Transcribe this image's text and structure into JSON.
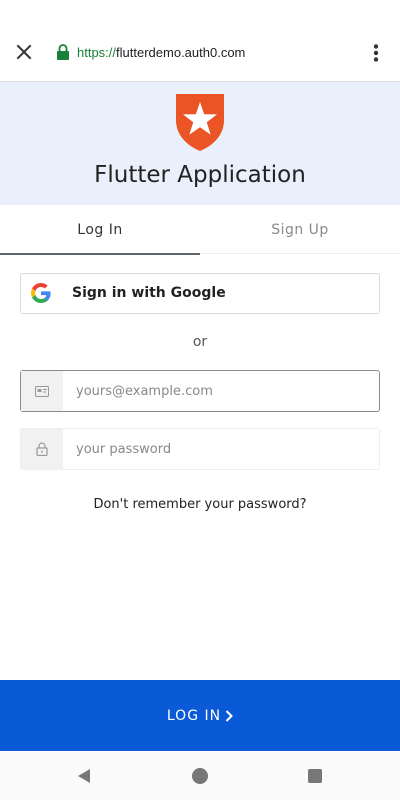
{
  "browser": {
    "url_scheme": "https://",
    "url_host": "flutterdemo.auth0.com",
    "accent_color": "#188038"
  },
  "header": {
    "title": "Flutter Application",
    "logo_icon": "auth0-shield-star-icon",
    "logo_color": "#eb5424",
    "background": "#e9f0fb"
  },
  "tabs": [
    {
      "label": "Log In",
      "active": true
    },
    {
      "label": "Sign Up",
      "active": false
    }
  ],
  "google_button": {
    "label": "Sign in with Google",
    "icon": "google-g-icon"
  },
  "separator": "or",
  "email_input": {
    "placeholder": "yours@example.com",
    "value": "",
    "icon": "id-card-icon"
  },
  "password_input": {
    "placeholder": "your password",
    "value": "",
    "icon": "lock-icon"
  },
  "forgot_password": "Don't remember your password?",
  "submit_button": {
    "label": "LOG IN",
    "color": "#0a5ad7",
    "icon": "chevron-right-icon"
  }
}
